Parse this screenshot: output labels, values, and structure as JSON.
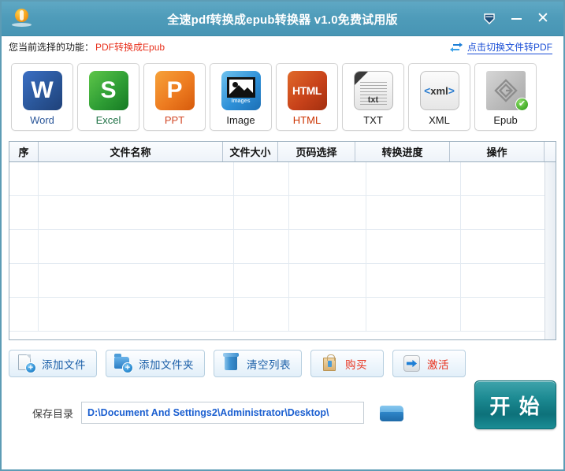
{
  "window": {
    "title": "全速pdf转换成epub转换器 v1.0免费试用版",
    "logo_icon": "app-logo-icon",
    "controls": {
      "pin": "pin-collapse-icon",
      "minimize": "minimize-icon",
      "close": "close-icon"
    }
  },
  "func_bar": {
    "label": "您当前选择的功能：",
    "value": "PDF转换成Epub",
    "switch_icon": "swap-arrows-icon",
    "switch_label": "点击切换文件转PDF"
  },
  "formats": [
    {
      "label": "Word",
      "glyph": "W",
      "icon": "word-icon",
      "selected": false
    },
    {
      "label": "Excel",
      "glyph": "S",
      "icon": "excel-icon",
      "selected": false
    },
    {
      "label": "PPT",
      "glyph": "P",
      "icon": "ppt-icon",
      "selected": false
    },
    {
      "label": "Image",
      "glyph": "images",
      "icon": "image-icon",
      "selected": false
    },
    {
      "label": "HTML",
      "glyph": "HTML",
      "icon": "html-icon",
      "selected": false
    },
    {
      "label": "TXT",
      "glyph": "txt",
      "icon": "txt-icon",
      "selected": false
    },
    {
      "label": "XML",
      "glyph": "xml",
      "icon": "xml-icon",
      "selected": false
    },
    {
      "label": "Epub",
      "glyph": "e",
      "icon": "epub-icon",
      "selected": true
    }
  ],
  "table": {
    "columns": [
      "序",
      "文件名称",
      "文件大小",
      "页码选择",
      "转换进度",
      "操作"
    ],
    "rows": [],
    "empty_row_count": 5
  },
  "actions": [
    {
      "label": "添加文件",
      "icon": "add-file-icon",
      "color": "blue"
    },
    {
      "label": "添加文件夹",
      "icon": "add-folder-icon",
      "color": "blue"
    },
    {
      "label": "清空列表",
      "icon": "trash-icon",
      "color": "blue"
    },
    {
      "label": "购买",
      "icon": "shopping-bag-icon",
      "color": "red"
    },
    {
      "label": "激活",
      "icon": "activate-arrow-icon",
      "color": "red"
    }
  ],
  "save": {
    "label": "保存目录",
    "path": "D:\\Document And Settings2\\Administrator\\Desktop\\",
    "browse_icon": "folder-browse-icon",
    "start_label": "开 始"
  },
  "colors": {
    "titlebar": "#4f9cba",
    "accent_red": "#e8321e",
    "link_blue": "#1b4fd6",
    "start_teal": "#1d8b93",
    "window_border": "#5d9cb5",
    "check_green": "#49b02c"
  }
}
